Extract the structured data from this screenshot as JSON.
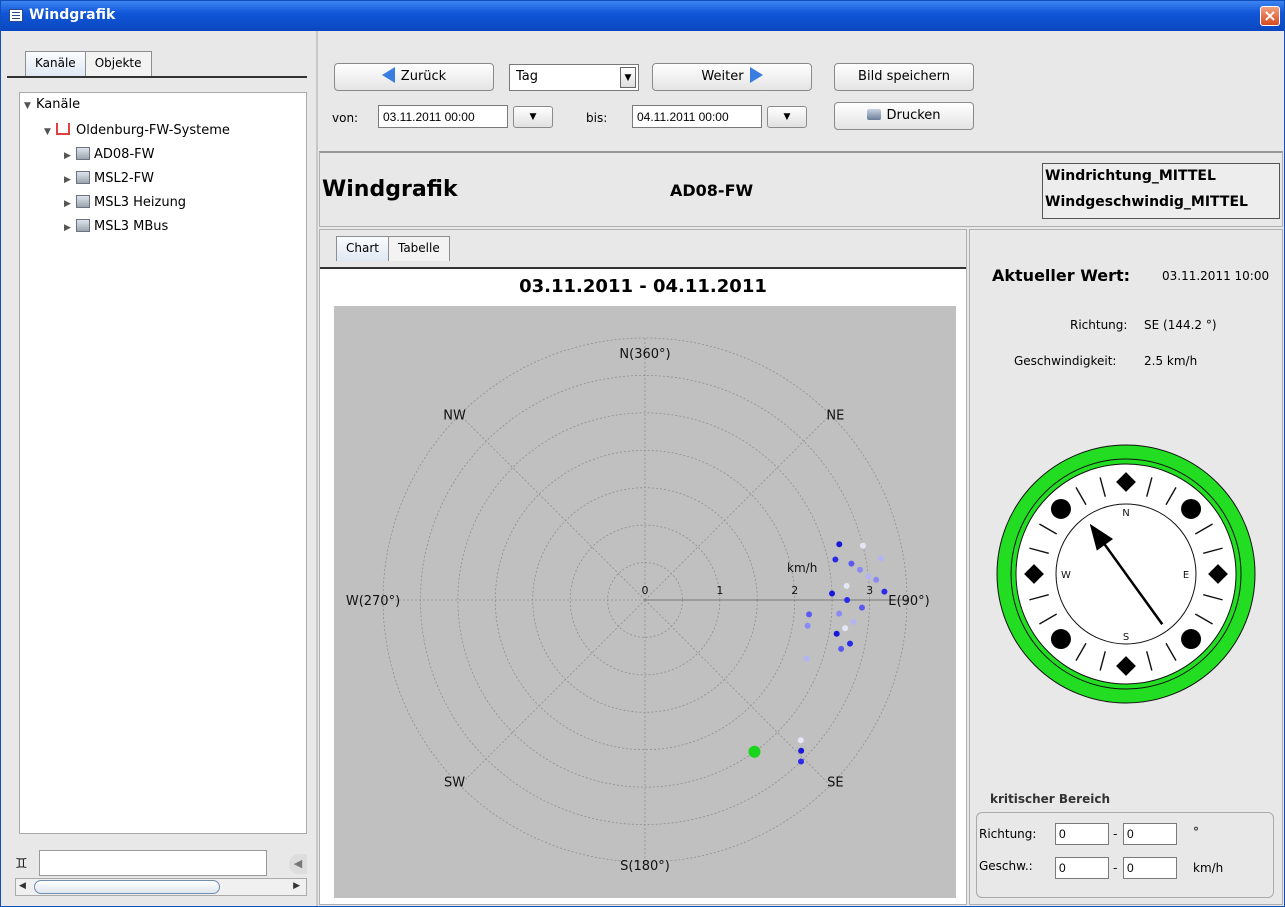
{
  "window": {
    "title": "Windgrafik"
  },
  "left": {
    "tabs": [
      "Kanäle",
      "Objekte"
    ],
    "tree": {
      "root": "Kanäle",
      "group": "Oldenburg-FW-Systeme",
      "items": [
        "AD08-FW",
        "MSL2-FW",
        "MSL3 Heizung",
        "MSL3 MBus"
      ]
    },
    "search_value": ""
  },
  "toolbar": {
    "back_label": "Zurück",
    "period": "Tag",
    "next_label": "Weiter",
    "save_image_label": "Bild speichern",
    "print_label": "Drucken",
    "from_label": "von:",
    "from_value": "03.11.2011 00:00",
    "to_label": "bis:",
    "to_value": "04.11.2011 00:00"
  },
  "header": {
    "title": "Windgrafik",
    "object": "AD08-FW",
    "channels": [
      "Windrichtung_MITTEL",
      "Windgeschwindig_MITTEL"
    ]
  },
  "chart_tabs": [
    "Chart",
    "Tabelle"
  ],
  "chart_data": {
    "type": "scatter",
    "title": "03.11.2011 - 04.11.2011",
    "coordinate_system": "polar",
    "radial_label": "km/h",
    "radial_ticks": [
      0,
      1,
      2,
      3
    ],
    "radial_max": 3.5,
    "ring_step": 0.5,
    "direction_labels": [
      "N(360°)",
      "NE",
      "E(90°)",
      "SE",
      "S(180°)",
      "SW",
      "W(270°)",
      "NW"
    ],
    "background_color": "#c0c0c0",
    "points": [
      {
        "dir": 78,
        "speed": 2.6
      },
      {
        "dir": 80,
        "speed": 2.8
      },
      {
        "dir": 82,
        "speed": 2.9
      },
      {
        "dir": 84,
        "speed": 3.0
      },
      {
        "dir": 86,
        "speed": 2.7
      },
      {
        "dir": 88,
        "speed": 2.5
      },
      {
        "dir": 90,
        "speed": 2.7
      },
      {
        "dir": 92,
        "speed": 2.9
      },
      {
        "dir": 94,
        "speed": 2.6
      },
      {
        "dir": 96,
        "speed": 2.8
      },
      {
        "dir": 98,
        "speed": 2.7
      },
      {
        "dir": 100,
        "speed": 2.6
      },
      {
        "dir": 102,
        "speed": 2.8
      },
      {
        "dir": 104,
        "speed": 2.7
      },
      {
        "dir": 85,
        "speed": 3.1
      },
      {
        "dir": 80,
        "speed": 3.2
      },
      {
        "dir": 76,
        "speed": 3.0
      },
      {
        "dir": 74,
        "speed": 2.7
      },
      {
        "dir": 88,
        "speed": 3.2
      },
      {
        "dir": 95,
        "speed": 2.2
      },
      {
        "dir": 99,
        "speed": 2.2
      },
      {
        "dir": 110,
        "speed": 2.3
      },
      {
        "dir": 132,
        "speed": 2.8
      },
      {
        "dir": 134,
        "speed": 2.9
      },
      {
        "dir": 136,
        "speed": 3.0
      },
      {
        "dir": 144.2,
        "speed": 2.5,
        "current": true
      }
    ]
  },
  "current": {
    "label": "Aktueller Wert:",
    "timestamp": "03.11.2011 10:00",
    "direction_label": "Richtung:",
    "direction_value": "SE (144.2 °)",
    "speed_label": "Geschwindigkeit:",
    "speed_value": "2.5 km/h",
    "direction_deg": 144.2
  },
  "compass": {
    "letters": [
      "N",
      "E",
      "S",
      "W"
    ],
    "ring_color": "#22dd22"
  },
  "critical": {
    "title": "kritischer Bereich",
    "dir_label": "Richtung:",
    "dir_from": "0",
    "dir_sep": "-",
    "dir_to": "0",
    "dir_unit": "°",
    "speed_label": "Geschw.:",
    "speed_from": "0",
    "speed_sep": "-",
    "speed_to": "0",
    "speed_unit": "km/h"
  },
  "colors": {
    "accent": "#3a7de0",
    "titlebar": "#1157d8",
    "current_point": "#1ad61a"
  }
}
